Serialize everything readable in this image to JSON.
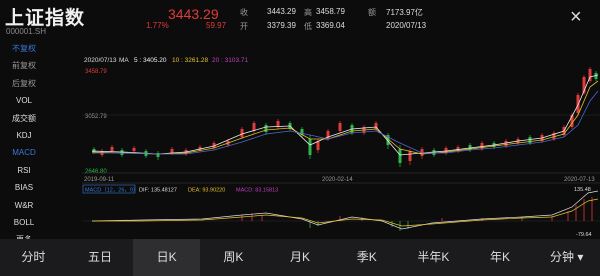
{
  "header": {
    "title": "上证指数",
    "code": "000001.SH",
    "price": "3443.29",
    "change_pct": "1.77%",
    "change_abs": "59.97",
    "stats": [
      {
        "label": "收",
        "value": "3443.29"
      },
      {
        "label": "高",
        "value": "3458.79"
      },
      {
        "label": "额",
        "value": "7173.97亿"
      },
      {
        "label": "开",
        "value": "3379.39"
      },
      {
        "label": "低",
        "value": "3369.04"
      },
      {
        "label": "",
        "value": "2020/07/13"
      }
    ],
    "close_icon": "×"
  },
  "sidebar": [
    "不复权",
    "前复权",
    "后复权",
    "VOL",
    "成交额",
    "KDJ",
    "MACD",
    "RSI",
    "BIAS",
    "W&R",
    "BOLL",
    "更多"
  ],
  "main_chart": {
    "date": "2020/07/13",
    "ma_label": "MA",
    "ma5": "5 : 3405.20",
    "ma10": "10 : 3261.28",
    "ma20": "20 : 3103.71",
    "high_label": "3458.79",
    "mid_label": "3052.79",
    "low_label": "2646.80",
    "x_labels": [
      "2019-09-11",
      "2020-02-14",
      "2020-07-13"
    ]
  },
  "macd_chart": {
    "name": "MACD（12，26，9）",
    "dif": "DIF: 135.48127",
    "dea": "DEA: 93.90220",
    "macd": "MACD: 83.15813",
    "top": "135.48",
    "bottom": "-79.64"
  },
  "tabs": [
    "分时",
    "五日",
    "日K",
    "周K",
    "月K",
    "季K",
    "半年K",
    "年K",
    "分钟"
  ],
  "colors": {
    "up": "#e03a3a",
    "down": "#2bb54b",
    "ma5": "#f0f0f0",
    "ma10": "#e6c229",
    "ma20": "#c040c0",
    "accent": "#3a78d8"
  }
}
